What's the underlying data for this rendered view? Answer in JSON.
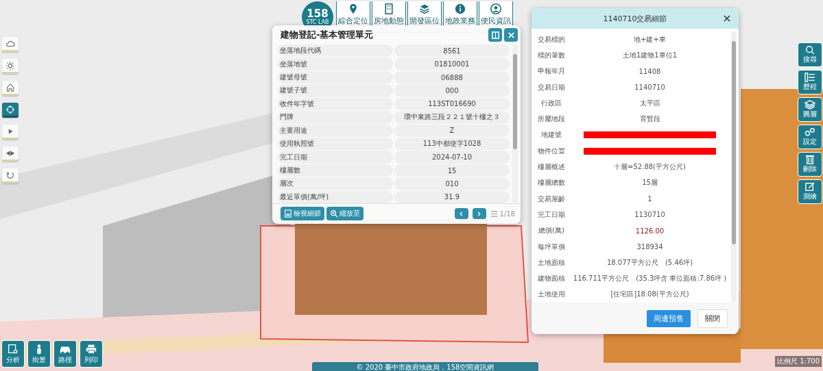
{
  "logo": {
    "number": "158",
    "sub": "STC LAB"
  },
  "nav": [
    {
      "label": "綜合定位",
      "kind": "pin"
    },
    {
      "label": "房地動態",
      "kind": "building"
    },
    {
      "label": "開發區位",
      "kind": "layers"
    },
    {
      "label": "地政業務",
      "kind": "info"
    },
    {
      "label": "便民資訊",
      "kind": "user"
    }
  ],
  "left_tools": [
    {
      "kind": "cloud",
      "selected": false
    },
    {
      "kind": "sun",
      "selected": false
    },
    {
      "kind": "home",
      "selected": false
    },
    {
      "kind": "target",
      "selected": true
    },
    {
      "kind": "play",
      "selected": false
    },
    {
      "kind": "arrows",
      "selected": false
    },
    {
      "kind": "rotate",
      "selected": false
    }
  ],
  "building_panel": {
    "title": "建物登記-基本管理單元",
    "rows": [
      {
        "label": "坐落地段代碼",
        "value": "8561"
      },
      {
        "label": "坐落地號",
        "value": "01810001"
      },
      {
        "label": "建號母號",
        "value": "06888"
      },
      {
        "label": "建號子號",
        "value": "000"
      },
      {
        "label": "收件年字號",
        "value": "113ST016690"
      },
      {
        "label": "門牌",
        "value": "環中東路三段２２１號十樓之３"
      },
      {
        "label": "主要用途",
        "value": "Z"
      },
      {
        "label": "使用執照號",
        "value": "113中都使字1028"
      },
      {
        "label": "完工日期",
        "value": "2024-07-10"
      },
      {
        "label": "樓層數",
        "value": "15"
      },
      {
        "label": "層次",
        "value": "010"
      },
      {
        "label": "最近單價(萬/坪)",
        "value": "31.9"
      }
    ],
    "buttons": [
      {
        "label": "檢視細節",
        "kind": "doc"
      },
      {
        "label": "縮放至",
        "kind": "zoom"
      }
    ],
    "pager": "1/18"
  },
  "trade_panel": {
    "title": "1140710交易細節",
    "rows": [
      {
        "label": "交易標的",
        "value": "地+建+車",
        "kind": "text"
      },
      {
        "label": "標的筆數",
        "value": "土地1建物1車位1",
        "kind": "text"
      },
      {
        "label": "申報年月",
        "value": "11408",
        "kind": "text"
      },
      {
        "label": "交易日期",
        "value": "1140710",
        "kind": "text"
      },
      {
        "label": "行政區",
        "value": "太平區",
        "kind": "text"
      },
      {
        "label": "所屬地段",
        "value": "育賢段",
        "kind": "text"
      },
      {
        "label": "地建號",
        "kind": "redacted"
      },
      {
        "label": "物件位置",
        "kind": "redacted"
      },
      {
        "label": "樓層概述",
        "value": "十層=52.88(平方公尺)",
        "kind": "text"
      },
      {
        "label": "樓層總數",
        "value": "15層",
        "kind": "text"
      },
      {
        "label": "交易屋齡",
        "value": "1",
        "kind": "text"
      },
      {
        "label": "完工日期",
        "value": "1130710",
        "kind": "text"
      },
      {
        "label": "總價(萬)",
        "value": "1126.00",
        "kind": "price"
      },
      {
        "label": "每坪單價",
        "value": "318934",
        "kind": "text"
      },
      {
        "label": "土地面積",
        "value": "18.077平方公尺　(5.46坪)",
        "kind": "text"
      },
      {
        "label": "建物面積",
        "value": "116.711平方公尺　(35.3坪含 車位面積:7.86坪 )",
        "kind": "text"
      },
      {
        "label": "土地使用",
        "value": "[住宅區]18.08(平方公尺)",
        "kind": "text"
      }
    ],
    "buttons": [
      {
        "label": "周邊預售",
        "kind": "primary"
      },
      {
        "label": "關閉",
        "kind": "plain"
      }
    ]
  },
  "right_tools": [
    {
      "label": "搜尋",
      "kind": "search"
    },
    {
      "label": "歷程",
      "kind": "list"
    },
    {
      "label": "圖層",
      "kind": "layers"
    },
    {
      "label": "設定",
      "kind": "gears"
    },
    {
      "label": "刪除",
      "kind": "trash"
    },
    {
      "label": "測繪",
      "kind": "pen"
    }
  ],
  "bottom_tools": [
    {
      "label": "分析",
      "kind": "doc"
    },
    {
      "label": "街景",
      "kind": "person"
    },
    {
      "label": "路徑",
      "kind": "car"
    },
    {
      "label": "列印",
      "kind": "printer"
    }
  ],
  "scale": "比例尺 1:700",
  "footer": "© 2020 臺中市政府地政局．158空間資訊網"
}
